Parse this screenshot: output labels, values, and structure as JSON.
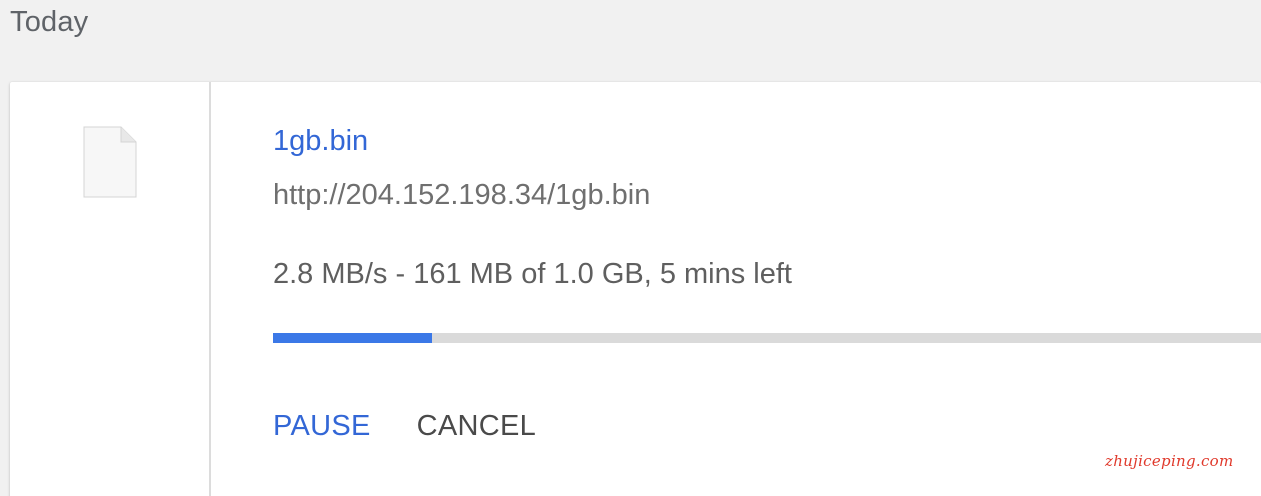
{
  "section": {
    "title": "Today"
  },
  "download": {
    "file_icon": "blank-file-icon",
    "file_name": "1gb.bin",
    "url": "http://204.152.198.34/1gb.bin",
    "status": "2.8 MB/s - 161 MB of 1.0 GB, 5 mins left",
    "progress_fraction": 0.161,
    "progress_color": "#3b78e7",
    "actions": {
      "pause_label": "PAUSE",
      "cancel_label": "CANCEL"
    }
  },
  "watermark": {
    "text": "zhujiceping.com"
  },
  "colors": {
    "link": "#3367d6",
    "background": "#f1f1f1",
    "card": "#ffffff",
    "watermark": "#e0392b"
  }
}
